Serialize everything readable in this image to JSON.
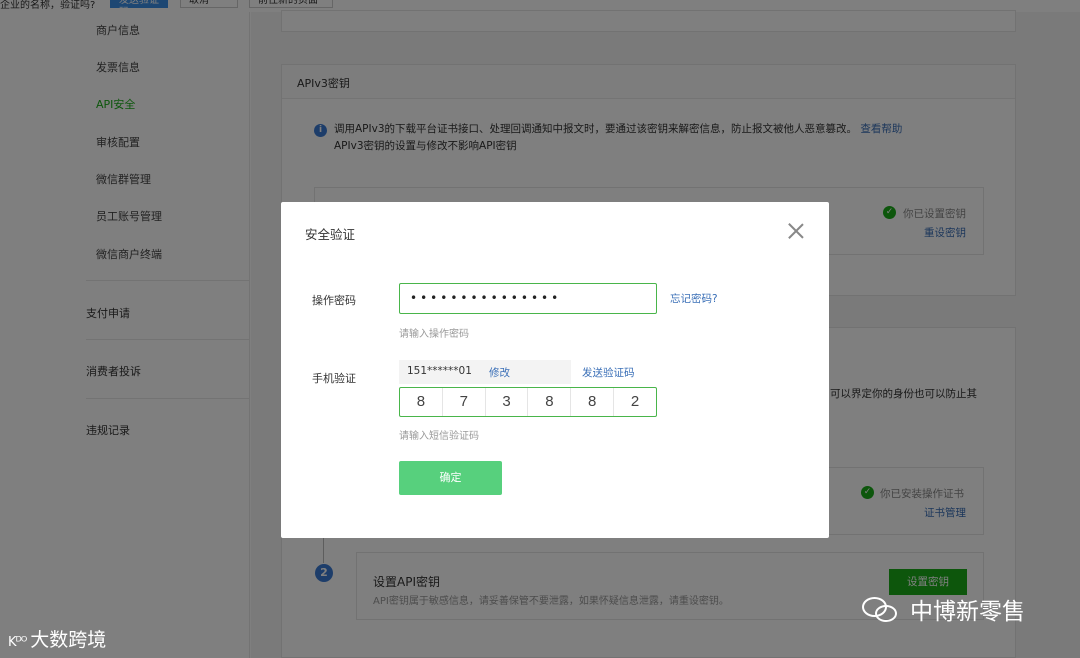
{
  "topbar": {
    "fragment_text": "企业的名称，验证吗?",
    "primary_button": "发送验证码",
    "cancel_button": "取消",
    "other_button": "前往新的页面"
  },
  "sidebar": {
    "items": [
      {
        "label": "商户信息"
      },
      {
        "label": "发票信息"
      },
      {
        "label": "API安全",
        "active": true
      },
      {
        "label": "审核配置"
      },
      {
        "label": "微信群管理"
      },
      {
        "label": "员工账号管理"
      },
      {
        "label": "微信商户终端"
      }
    ],
    "groups": [
      {
        "label": "支付申请"
      },
      {
        "label": "消费者投诉"
      },
      {
        "label": "违规记录"
      }
    ]
  },
  "main": {
    "apiv3_card": {
      "title": "APIv3密钥",
      "info_line1": "调用APIv3的下载平台证书接口、处理回调通知中报文时，要通过该密钥来解密信息，防止报文被他人恶意篡改。",
      "help_link": "查看帮助",
      "info_line2": "APIv3密钥的设置与修改不影响API密钥",
      "status_text": "你已设置密钥",
      "reset_link": "重设密钥"
    },
    "api_card": {
      "partial_text": "可以界定你的身份也可以防止其",
      "cert_status": "你已安装操作证书",
      "cert_link": "证书管理",
      "step_number": "2",
      "step_title": "设置API密钥",
      "step_desc": "API密钥属于敏感信息，请妥善保管不要泄露，如果怀疑信息泄露，请重设密钥。",
      "step_button": "设置密钥"
    }
  },
  "modal": {
    "title": "安全验证",
    "password_label": "操作密码",
    "password_value": "•••••••••••••••",
    "password_hint": "请输入操作密码",
    "forgot_link": "忘记密码?",
    "phone_label": "手机验证",
    "phone_number": "151******01",
    "phone_edit": "修改",
    "send_code": "发送验证码",
    "code_digits": [
      "8",
      "7",
      "3",
      "8",
      "8",
      "2"
    ],
    "code_hint": "请输入短信验证码",
    "confirm_button": "确定"
  },
  "watermarks": {
    "left_logo": "Kᴰᴼ",
    "left_text": "大数跨境",
    "right_text": "中博新零售"
  },
  "colors": {
    "accent_green": "#1aad19",
    "confirm_green": "#57d07d",
    "link_blue": "#3a6fb7",
    "info_blue": "#3a7bd5"
  }
}
